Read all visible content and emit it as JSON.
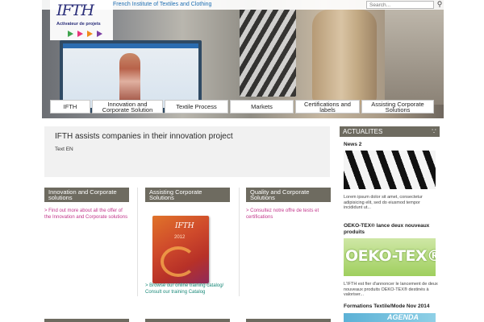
{
  "header": {
    "tagline": "French Institute of Textiles and Clothing",
    "logo_text": "IFTH",
    "logo_sub": "Activateur de projets",
    "search_placeholder": "Search..."
  },
  "nav": {
    "items": [
      {
        "label": "IFTH"
      },
      {
        "label": "Innovation and Corporate Solution"
      },
      {
        "label": "Textile Process"
      },
      {
        "label": "Markets"
      },
      {
        "label": "Certifications and labels"
      },
      {
        "label": "Assisting Corporate Solutions"
      }
    ]
  },
  "main": {
    "title": "IFTH assists companies in their innovation project",
    "text": "Text EN"
  },
  "columns": [
    {
      "title": "Innovation and Corporate solutions",
      "link": "> Find out more about all the offer of the Innovation and Corporate solutions"
    },
    {
      "title": "Assisting Corporate Solutions",
      "link": "> Browse our online training catalog/ Consult our training Catalog",
      "image_logo": "IFTH",
      "image_year": "2012"
    },
    {
      "title": "Quality and Corporate Solutions",
      "link": "> Consultez notre offre de tests et certifications"
    }
  ],
  "sidebar": {
    "header": "ACTUALITES",
    "items": [
      {
        "title": "News 2",
        "text": "Lorem ipsum dolor sit amet, consectetur adipisicing elit, sed do eiusmod tempor incididunt ut..."
      },
      {
        "title": "OEKO-TEX® lance deux nouveaux produits",
        "image_text": "OEKO-TEX®",
        "text": "L'IFTH est fier d'annoncer le lancement de deux nouveaux produits OEKO-TEX® destinés à valoriser..."
      },
      {
        "title": "Formations Textile/Mode Nov 2014",
        "image_text": "AGENDA"
      }
    ]
  },
  "colors": {
    "accent_gray": "#6e6b60",
    "link_pink": "#c2348a",
    "link_teal": "#1b8a7a",
    "brand_blue": "#2b2f7a",
    "logo_triangles": [
      "#3fa34d",
      "#e7357b",
      "#f08c1a",
      "#7b3fa3"
    ]
  },
  "icons": [
    "search-icon",
    "rss-icon"
  ]
}
